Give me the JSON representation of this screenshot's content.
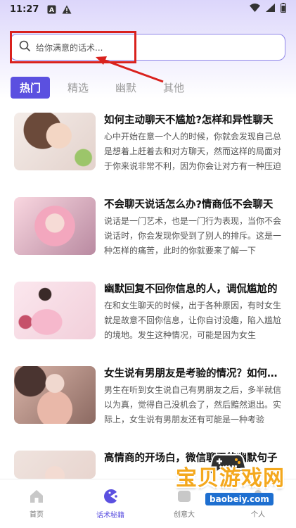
{
  "status_bar": {
    "time": "11:27",
    "icons": [
      "a-icon",
      "warning-icon",
      "wifi-icon",
      "signal-icon",
      "battery-icon"
    ]
  },
  "search": {
    "placeholder": "给你满意的话术..."
  },
  "tabs": [
    {
      "label": "热门",
      "active": true
    },
    {
      "label": "精选",
      "active": false
    },
    {
      "label": "幽默",
      "active": false
    },
    {
      "label": "其他",
      "active": false
    }
  ],
  "articles": [
    {
      "title": "如何主动聊天不尴尬?怎样和异性聊天",
      "desc": "心中开始在意一个人的时候，你就会发现自己总是想着上赶着去和对方聊天，然而这样的局面对于你来说非常不利，因为你会让对方有一种压迫感"
    },
    {
      "title": "不会聊天说话怎么办?情商低不会聊天",
      "desc": "说话是一门艺术，也是一门行为表现，当你不会说话时，你会发现你受到了别人的排斥。这是一种怎样的痛苦，此时的你就要来了解一下"
    },
    {
      "title": "幽默回复不回你信息的人，调侃尴尬的",
      "desc": "在和女生聊天的时候，出于各种原因，有时女生就是故意不回你信息，让你自讨没趣，陷入尴尬的境地。发生这种情况，可能是因为女生"
    },
    {
      "title": "女生说有男朋友是考验的情况？如何应对",
      "desc": "男生在听到女生说自己有男朋友之后，多半就信以为真，觉得自己没机会了，然后黯然退出。实际上，女生说有男朋友还有可能是一种考验"
    },
    {
      "title": "高情商的开场白，微信聊天的幽默句子",
      "desc": ""
    }
  ],
  "bottom_nav": [
    {
      "label": "首页",
      "icon": "home-icon",
      "active": false
    },
    {
      "label": "话术秘籍",
      "icon": "pacman-icon",
      "active": true
    },
    {
      "label": "创意大",
      "icon": "creative-icon",
      "active": false
    },
    {
      "label": "个人",
      "icon": "person-icon",
      "active": false
    }
  ],
  "watermark": {
    "main_text": "宝贝游戏网",
    "url": "baobeiy.com"
  },
  "colors": {
    "accent": "#5b50e0",
    "annotation_red": "#d9211d",
    "search_border": "#8f86e8"
  }
}
